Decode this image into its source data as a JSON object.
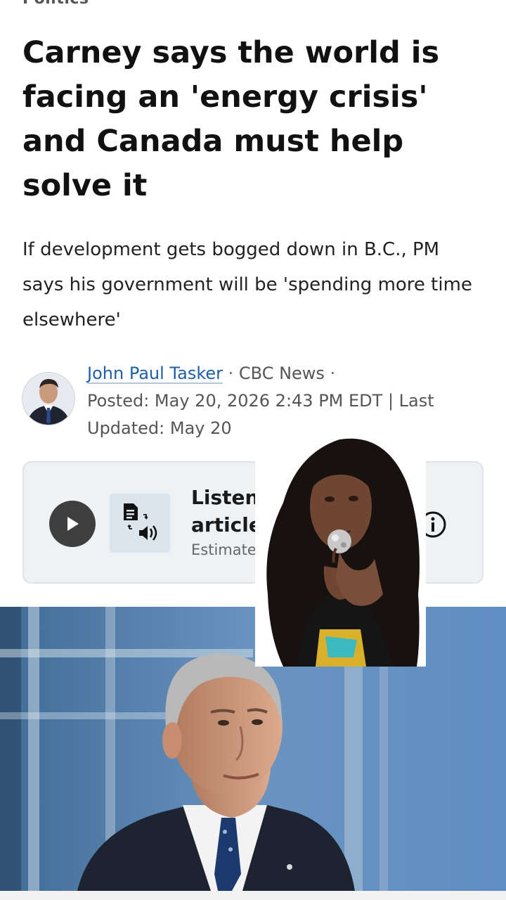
{
  "section": {
    "label": "Politics"
  },
  "article": {
    "headline": "Carney says the world is facing an 'energy crisis' and Canada must help solve it",
    "deck": "If development gets bogged down in B.C., PM says his government will be 'spending more time elsewhere'",
    "byline": {
      "author": "John Paul Tasker",
      "separator": " · ",
      "outlet": "CBC News",
      "trailing_separator": " ·",
      "posted": "Posted: May 20, 2026 2:43 PM EDT | Last Updated: May 20"
    }
  },
  "listen": {
    "title": "Listen to this article",
    "title_visible": "Listen to article",
    "subtitle": "Estimated",
    "play_icon": "play-icon",
    "tts_icon": "document-to-audio-icon",
    "info_icon": "info-icon"
  },
  "colors": {
    "link": "#1f5fa8",
    "card_bg": "#eef2f5",
    "play_bg": "#3f3f3f",
    "text": "#111111"
  }
}
